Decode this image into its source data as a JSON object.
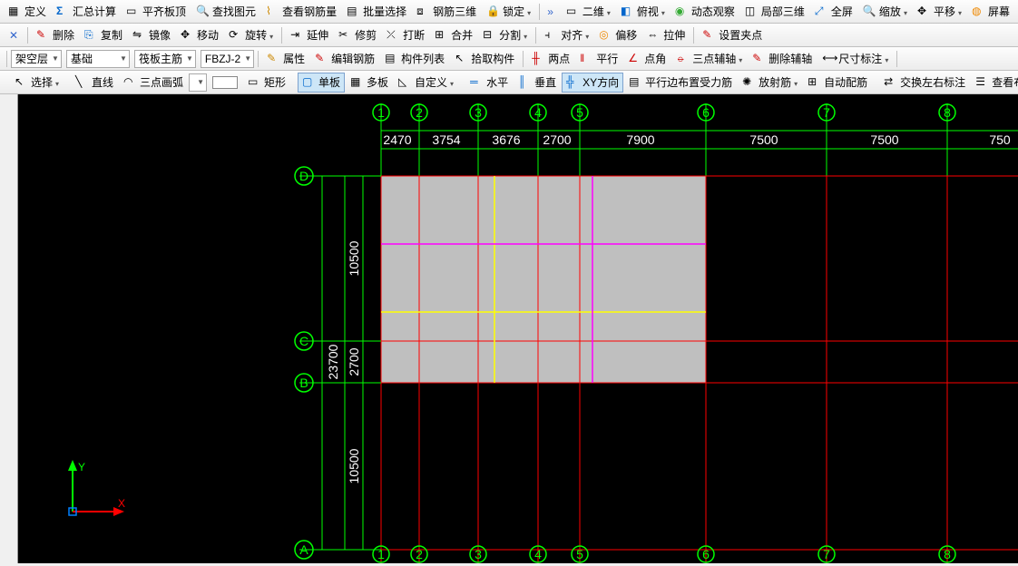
{
  "tb1": {
    "define": "定义",
    "sum": "汇总计算",
    "flat": "平齐板顶",
    "find": "查找图元",
    "rebar": "查看钢筋量",
    "batch": "批量选择",
    "steel3d": "钢筋三维",
    "lock": "锁定",
    "view2d": "二维",
    "persp": "俯视",
    "dyn": "动态观察",
    "local3d": "局部三维",
    "full": "全屏",
    "zoom": "缩放",
    "pan": "平移",
    "screen": "屏幕"
  },
  "tb2": {
    "delete": "删除",
    "copy": "复制",
    "mirror": "镜像",
    "move": "移动",
    "rotate": "旋转",
    "extend": "延伸",
    "trim": "修剪",
    "break": "打断",
    "join": "合并",
    "split": "分割",
    "align": "对齐",
    "offset": "偏移",
    "stretch": "拉伸",
    "grip": "设置夹点"
  },
  "tb3": {
    "layer": "架空层",
    "base": "基础",
    "raft": "筏板主筋",
    "code": "FBZJ-2",
    "prop": "属性",
    "editbar": "编辑钢筋",
    "list": "构件列表",
    "pick": "拾取构件",
    "twopt": "两点",
    "para": "平行",
    "ptang": "点角",
    "threept": "三点辅轴",
    "delaux": "删除辅轴",
    "dimlabel": "尺寸标注"
  },
  "tb4": {
    "select": "选择",
    "line": "直线",
    "arc3": "三点画弧",
    "rect": "矩形",
    "single": "单板",
    "multi": "多板",
    "custom": "自定义",
    "horiz": "水平",
    "vert": "垂直",
    "xydir": "XY方向",
    "edgebar": "平行边布置受力筋",
    "radial": "放射筋",
    "auto": "自动配筋",
    "swap": "交换左右标注",
    "viewlay": "查看布"
  },
  "axis": {
    "cols": [
      "1",
      "2",
      "3",
      "4",
      "5",
      "6",
      "7",
      "8"
    ],
    "rows": [
      "A",
      "B",
      "C",
      "D"
    ],
    "coldims": [
      "2470",
      "3754",
      "3676",
      "2700",
      "7900",
      "7500",
      "7500",
      "750"
    ],
    "rowdims": [
      "10500",
      "2700",
      "10500"
    ],
    "rowdim_outer": "23700"
  },
  "ucs": {
    "y": "Y",
    "x": "X"
  }
}
